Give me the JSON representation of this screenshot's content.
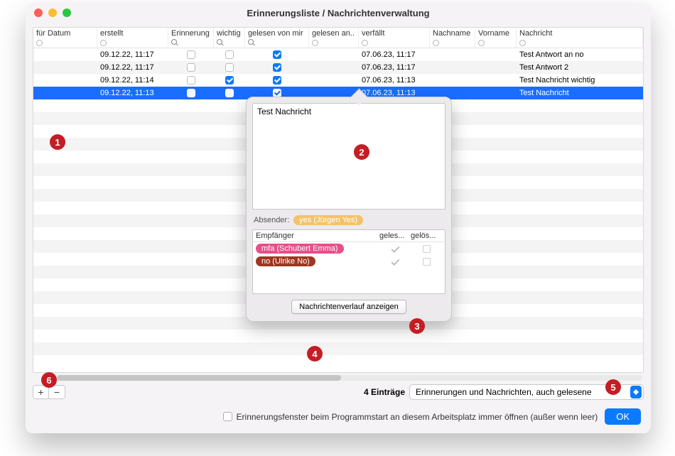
{
  "window": {
    "title": "Erinnerungsliste / Nachrichtenverwaltung"
  },
  "columns": {
    "c0": "für Datum",
    "c1": "erstellt",
    "c2": "Erinnerung",
    "c3": "wichtig",
    "c4": "gelesen von mir",
    "c5": "gelesen an...",
    "c6": "verfällt",
    "c7": "Nachname",
    "c8": "Vorname",
    "c9": "Nachricht"
  },
  "rows": [
    {
      "erstellt": "09.12.22, 11:17",
      "erinnerung": false,
      "wichtig": false,
      "gelesen": true,
      "verfaellt": "07.06.23, 11:17",
      "nachricht": "Test Antwort an no"
    },
    {
      "erstellt": "09.12.22, 11:17",
      "erinnerung": false,
      "wichtig": false,
      "gelesen": true,
      "verfaellt": "07.06.23, 11:17",
      "nachricht": "Test Antwort 2"
    },
    {
      "erstellt": "09.12.22, 11:14",
      "erinnerung": false,
      "wichtig": true,
      "gelesen": true,
      "verfaellt": "07.06.23, 11:13",
      "nachricht": "Test Nachricht wichtig"
    },
    {
      "erstellt": "09.12.22, 11:13",
      "erinnerung": false,
      "wichtig": false,
      "gelesen": true,
      "verfaellt": "07.06.23, 11:13",
      "nachricht": "Test Nachricht",
      "selected": true
    }
  ],
  "popover": {
    "message": "Test Nachricht",
    "sender_label": "Absender:",
    "sender": {
      "text": "yes (Jürgen Yes)",
      "color": "#f2c36b"
    },
    "recip_headers": {
      "h0": "Empfänger",
      "h1": "geles...",
      "h2": "gelös..."
    },
    "recipients": [
      {
        "name": "mfa (Schubert Emma)",
        "color": "#e84f8a",
        "read": true,
        "del": false
      },
      {
        "name": "no (Ulrike No)",
        "color": "#a03621",
        "read": true,
        "del": false
      }
    ],
    "history_btn": "Nachrichtenverlauf anzeigen"
  },
  "status": {
    "count": "4 Einträge",
    "filter": "Erinnerungen und Nachrichten, auch gelesene"
  },
  "footer": {
    "checkbox": "Erinnerungsfenster beim Programmstart an diesem Arbeitsplatz immer öffnen (außer wenn leer)",
    "ok": "OK"
  },
  "markers": {
    "m1": "1",
    "m2": "2",
    "m3": "3",
    "m4": "4",
    "m5": "5",
    "m6": "6"
  }
}
